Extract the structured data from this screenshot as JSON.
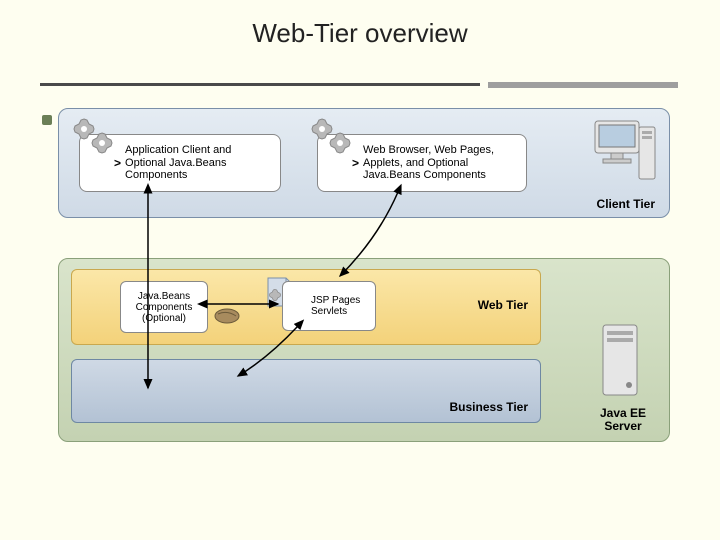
{
  "title": "Web-Tier overview",
  "client_tier": {
    "label": "Client Tier",
    "box1": "Application Client and Optional Java.Beans Components",
    "box2": "Web Browser, Web Pages, Applets, and Optional Java.Beans Components"
  },
  "web_tier": {
    "label": "Web Tier",
    "box1": "Java.Beans Components (Optional)",
    "box2": "JSP Pages Servlets"
  },
  "business_tier": {
    "label": "Business Tier"
  },
  "server": {
    "label": "Java EE Server"
  },
  "icons": {
    "gear": "gear-icon",
    "pc": "pc-icon",
    "tower": "server-tower-icon",
    "bean": "bean-icon",
    "doc": "document-icon"
  }
}
